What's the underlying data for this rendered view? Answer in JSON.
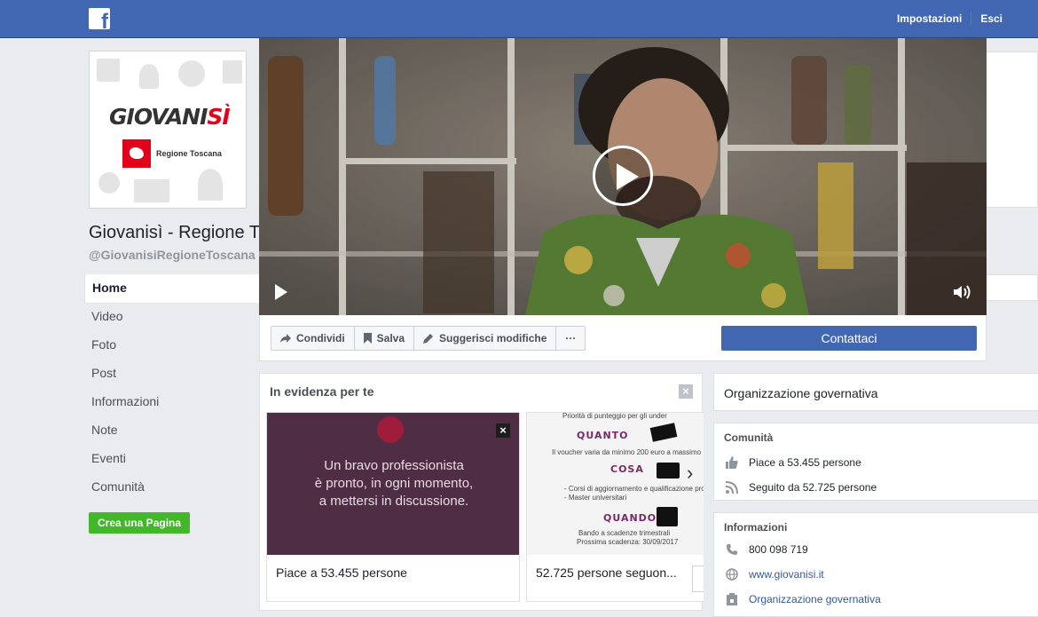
{
  "topbar": {
    "logo_letter": "f",
    "links": {
      "settings": "Impostazioni",
      "logout": "Esci"
    },
    "colors": {
      "bar": "#4267b2"
    }
  },
  "profile": {
    "logo_text_main": "GIOVANI",
    "logo_text_accent": "SÌ",
    "logo_region": "Regione Toscana",
    "name": "Giovanisì - Regione T",
    "handle": "@GiovanisiRegioneToscana"
  },
  "nav": {
    "items": [
      {
        "label": "Home"
      },
      {
        "label": "Video"
      },
      {
        "label": "Foto"
      },
      {
        "label": "Post"
      },
      {
        "label": "Informazioni"
      },
      {
        "label": "Note"
      },
      {
        "label": "Eventi"
      },
      {
        "label": "Comunità"
      }
    ],
    "create_page": "Crea una Pagina"
  },
  "video": {
    "play_icon": "play-icon",
    "volume_icon": "volume-icon"
  },
  "actions": {
    "share": "Condividi",
    "save": "Salva",
    "suggest": "Suggerisci modifiche",
    "more": "···",
    "contact": "Contattaci"
  },
  "highlights": {
    "title": "In evidenza per te",
    "item1": {
      "quote_l1": "Un bravo professionista",
      "quote_l2": "è pronto, in ogni momento,",
      "quote_l3": "a mettersi in discussione.",
      "caption": "Piace a 53.455 persone"
    },
    "item2": {
      "top_line": "Priorità di punteggio per gli under",
      "quanto": "QUANTO",
      "quanto_line": "Il voucher varia da minimo 200 euro a massimo",
      "cosa": "COSA",
      "cosa_line1": "- Corsi di aggiornamento e qualificazione professionale",
      "cosa_line2": "- Master universitari",
      "quando": "QUANDO",
      "quando_line1": "Bando a scadenze trimestrali",
      "quando_line2": "Prossima scadenza: 30/09/2017",
      "caption": "52.725 persone seguon..."
    }
  },
  "right": {
    "category": "Organizzazione governativa",
    "community": {
      "title": "Comunità",
      "likes": "Piace a 53.455 persone",
      "follows": "Seguito da 52.725 persone"
    },
    "info": {
      "title": "Informazioni",
      "phone": "800 098 719",
      "website": "www.giovanisi.it",
      "category": "Organizzazione governativa"
    }
  }
}
